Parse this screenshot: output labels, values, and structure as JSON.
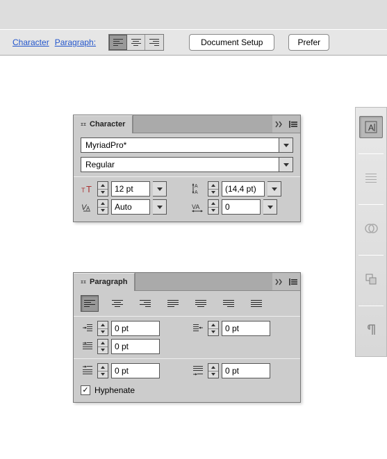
{
  "toolbar": {
    "link_character": "Character",
    "link_paragraph": "Paragraph:",
    "doc_setup": "Document Setup",
    "preferences": "Prefer"
  },
  "character_panel": {
    "title": "Character",
    "font_family": "MyriadPro*",
    "font_style": "Regular",
    "font_size": "12 pt",
    "leading": "(14,4 pt)",
    "kerning": "Auto",
    "tracking": "0"
  },
  "paragraph_panel": {
    "title": "Paragraph",
    "indent_left": "0 pt",
    "indent_right": "0 pt",
    "indent_first": "0 pt",
    "space_before": "0 pt",
    "space_after": "0 pt",
    "hyphenate_label": "Hyphenate",
    "hyphenate_checked": true
  }
}
